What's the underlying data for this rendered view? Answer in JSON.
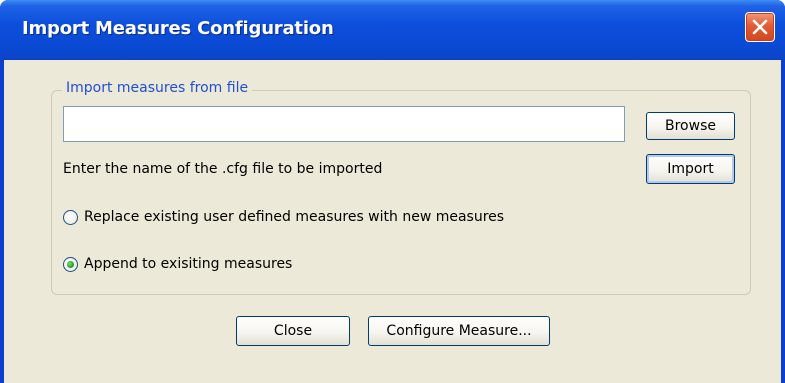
{
  "window": {
    "title": "Import Measures Configuration",
    "close_icon": "close-icon"
  },
  "group": {
    "label": "Import measures from file",
    "file_input_value": "",
    "hint": "Enter the name of the .cfg file to be imported",
    "browse_label": "Browse",
    "import_label": "Import",
    "options": [
      {
        "label": "Replace existing user defined measures with new measures",
        "selected": false
      },
      {
        "label": "Append to exisiting measures",
        "selected": true
      }
    ]
  },
  "footer": {
    "close_label": "Close",
    "configure_label": "Configure Measure..."
  },
  "colors": {
    "title_bar": "#0a49d2",
    "dialog_background": "#ece9d8",
    "group_label": "#1f4fd6",
    "close_button": "#e35a34",
    "radio_selected": "#21a121"
  }
}
